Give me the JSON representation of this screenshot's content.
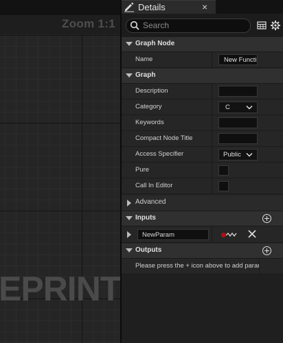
{
  "graph": {
    "zoom_label": "Zoom 1:1",
    "watermark": "EPRINT"
  },
  "details": {
    "tab_title": "Details",
    "tab_close": "×",
    "search_placeholder": "Search",
    "graph_node": {
      "title": "Graph Node",
      "name_label": "Name",
      "name_value": "New Functi"
    },
    "graph": {
      "title": "Graph",
      "rows": {
        "description": "Description",
        "category": "Category",
        "category_value": "C",
        "keywords": "Keywords",
        "compact_title": "Compact Node Title",
        "access_specifier": "Access Specifier",
        "access_value": "Public",
        "pure": "Pure",
        "call_in_editor": "Call In Editor"
      }
    },
    "advanced": {
      "title": "Advanced"
    },
    "inputs": {
      "title": "Inputs",
      "param_name": "NewParam",
      "pin_color": "#b01010"
    },
    "outputs": {
      "title": "Outputs",
      "hint": "Please press the + icon above to add paramete"
    }
  }
}
